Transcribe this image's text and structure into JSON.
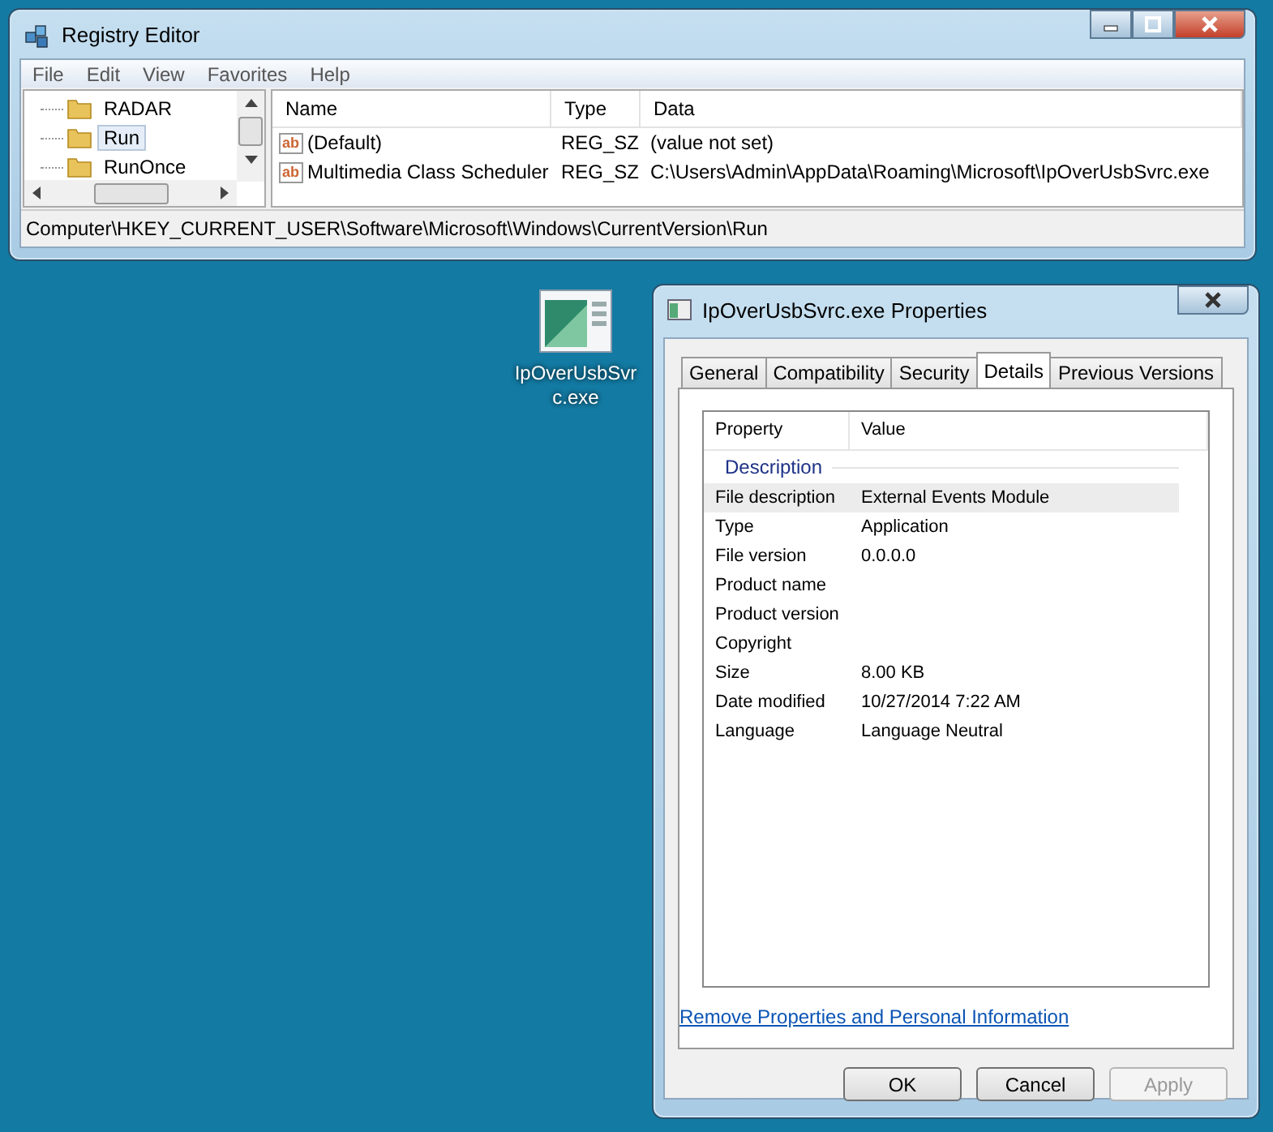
{
  "registry_editor": {
    "title": "Registry Editor",
    "menu": [
      "File",
      "Edit",
      "View",
      "Favorites",
      "Help"
    ],
    "tree": [
      {
        "label": "RADAR",
        "selected": false
      },
      {
        "label": "Run",
        "selected": true
      },
      {
        "label": "RunOnce",
        "selected": false
      }
    ],
    "columns": [
      "Name",
      "Type",
      "Data"
    ],
    "rows": [
      {
        "icon_text": "ab",
        "name": "(Default)",
        "type": "REG_SZ",
        "data": "(value not set)"
      },
      {
        "icon_text": "ab",
        "name": "Multimedia Class Scheduler",
        "type": "REG_SZ",
        "data": "C:\\Users\\Admin\\AppData\\Roaming\\Microsoft\\IpOverUsbSvrc.exe"
      }
    ],
    "status_bar": "Computer\\HKEY_CURRENT_USER\\Software\\Microsoft\\Windows\\CurrentVersion\\Run"
  },
  "desktop_icon": {
    "label_lines": [
      "IpOverUsbSvr",
      "c.exe"
    ]
  },
  "properties_dialog": {
    "title": "IpOverUsbSvrc.exe Properties",
    "tabs": [
      {
        "label": "General",
        "selected": false
      },
      {
        "label": "Compatibility",
        "selected": false
      },
      {
        "label": "Security",
        "selected": false
      },
      {
        "label": "Details",
        "selected": true
      },
      {
        "label": "Previous Versions",
        "selected": false
      }
    ],
    "columns": [
      "Property",
      "Value"
    ],
    "section": "Description",
    "properties": [
      {
        "property": "File description",
        "value": "External Events Module",
        "selected": true
      },
      {
        "property": "Type",
        "value": "Application",
        "selected": false
      },
      {
        "property": "File version",
        "value": "0.0.0.0",
        "selected": false
      },
      {
        "property": "Product name",
        "selected": false
      },
      {
        "property": "Product version",
        "selected": false
      },
      {
        "property": "Copyright",
        "selected": false
      },
      {
        "property": "Size",
        "value": "8.00 KB",
        "selected": false
      },
      {
        "property": "Date modified",
        "value": "10/27/2014 7:22 AM",
        "selected": false
      },
      {
        "property": "Language",
        "value": "Language Neutral",
        "selected": false
      }
    ],
    "link": "Remove Properties and Personal Information",
    "buttons": [
      {
        "label": "OK",
        "disabled": false
      },
      {
        "label": "Cancel",
        "disabled": false
      },
      {
        "label": "Apply",
        "disabled": true
      }
    ]
  }
}
